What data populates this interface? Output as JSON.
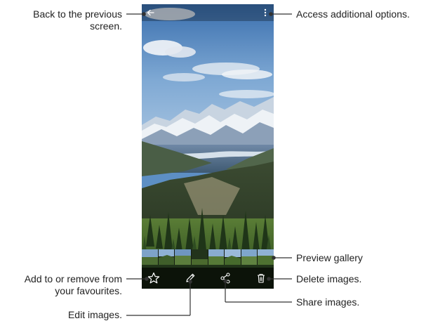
{
  "labels": {
    "back": [
      "Back to the previous",
      "screen."
    ],
    "options": "Access additional options.",
    "preview": "Preview gallery",
    "favourite": [
      "Add to or remove from",
      "your favourites."
    ],
    "delete": "Delete images.",
    "share": "Share images.",
    "edit": "Edit images."
  },
  "toolbar": {
    "icons": [
      "star-icon",
      "pencil-icon",
      "share-icon",
      "trash-icon"
    ]
  },
  "top_bar": {
    "icons": [
      "back-arrow-icon",
      "more-options-icon"
    ]
  },
  "colors": {
    "leader_line": "#333333",
    "bar_overlay": "#000000",
    "icon": "#ffffff"
  }
}
